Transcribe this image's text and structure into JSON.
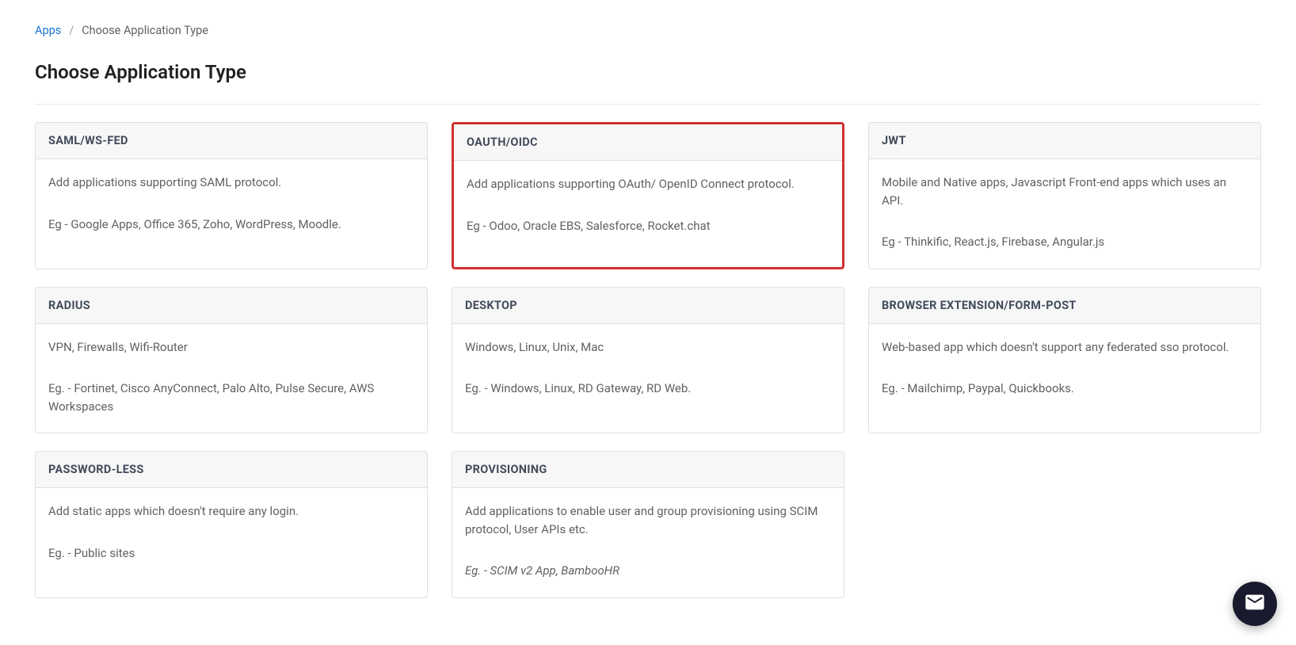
{
  "breadcrumb": {
    "link_label": "Apps",
    "separator": "/",
    "current": "Choose Application Type"
  },
  "page_title": "Choose Application Type",
  "cards": [
    {
      "title": "SAML/WS-FED",
      "description": "Add applications supporting SAML protocol.",
      "example": "Eg - Google Apps, Office 365, Zoho, WordPress, Moodle.",
      "highlighted": false,
      "italic_example": false
    },
    {
      "title": "OAUTH/OIDC",
      "description": "Add applications supporting OAuth/ OpenID Connect protocol.",
      "example": "Eg - Odoo, Oracle EBS, Salesforce, Rocket.chat",
      "highlighted": true,
      "italic_example": false
    },
    {
      "title": "JWT",
      "description": "Mobile and Native apps, Javascript Front-end apps which uses an API.",
      "example": "Eg - Thinkific, React.js, Firebase, Angular.js",
      "highlighted": false,
      "italic_example": false
    },
    {
      "title": "RADIUS",
      "description": "VPN, Firewalls, Wifi-Router",
      "example": "Eg. - Fortinet, Cisco AnyConnect, Palo Alto, Pulse Secure, AWS Workspaces",
      "highlighted": false,
      "italic_example": false
    },
    {
      "title": "DESKTOP",
      "description": "Windows, Linux, Unix, Mac",
      "example": "Eg. - Windows, Linux, RD Gateway, RD Web.",
      "highlighted": false,
      "italic_example": false
    },
    {
      "title": "BROWSER EXTENSION/FORM-POST",
      "description": "Web-based app which doesn't support any federated sso protocol.",
      "example": "Eg. - Mailchimp, Paypal, Quickbooks.",
      "highlighted": false,
      "italic_example": false
    },
    {
      "title": "PASSWORD-LESS",
      "description": "Add static apps which doesn't require any login.",
      "example": "Eg. - Public sites",
      "highlighted": false,
      "italic_example": false
    },
    {
      "title": "PROVISIONING",
      "description": "Add applications to enable user and group provisioning using SCIM protocol, User APIs etc.",
      "example": "Eg. - SCIM v2 App, BambooHR",
      "highlighted": false,
      "italic_example": true
    }
  ]
}
